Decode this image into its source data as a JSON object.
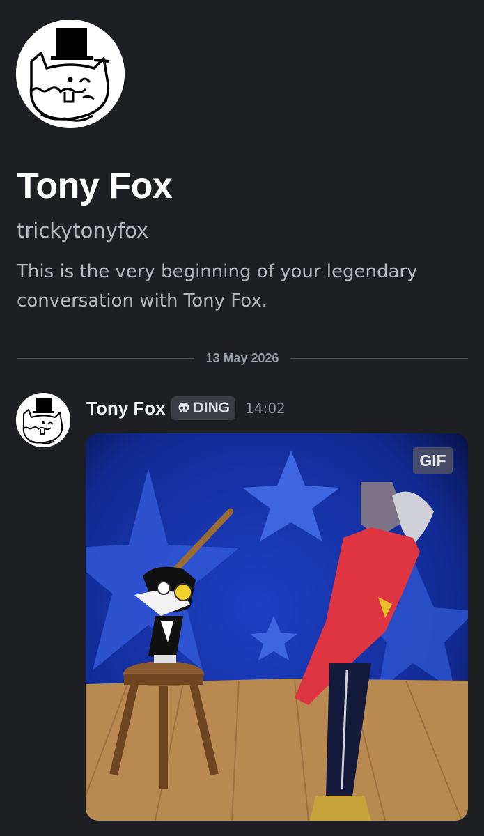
{
  "profile": {
    "display_name": "Tony Fox",
    "username": "trickytonyfox",
    "intro": "This is the very beginning of your legendary conversation with Tony Fox."
  },
  "divider": {
    "date": "13 May 2026"
  },
  "message": {
    "author": "Tony Fox",
    "tag": {
      "icon": "skull-icon",
      "label": "DING"
    },
    "timestamp": "14:02",
    "attachment": {
      "badge": "GIF"
    }
  },
  "colors": {
    "background": "#1e1f22",
    "text_primary": "#f2f3f5",
    "text_muted": "#b5bac1",
    "timestamp": "#949ba4",
    "tag_bg": "#3b3d44"
  }
}
